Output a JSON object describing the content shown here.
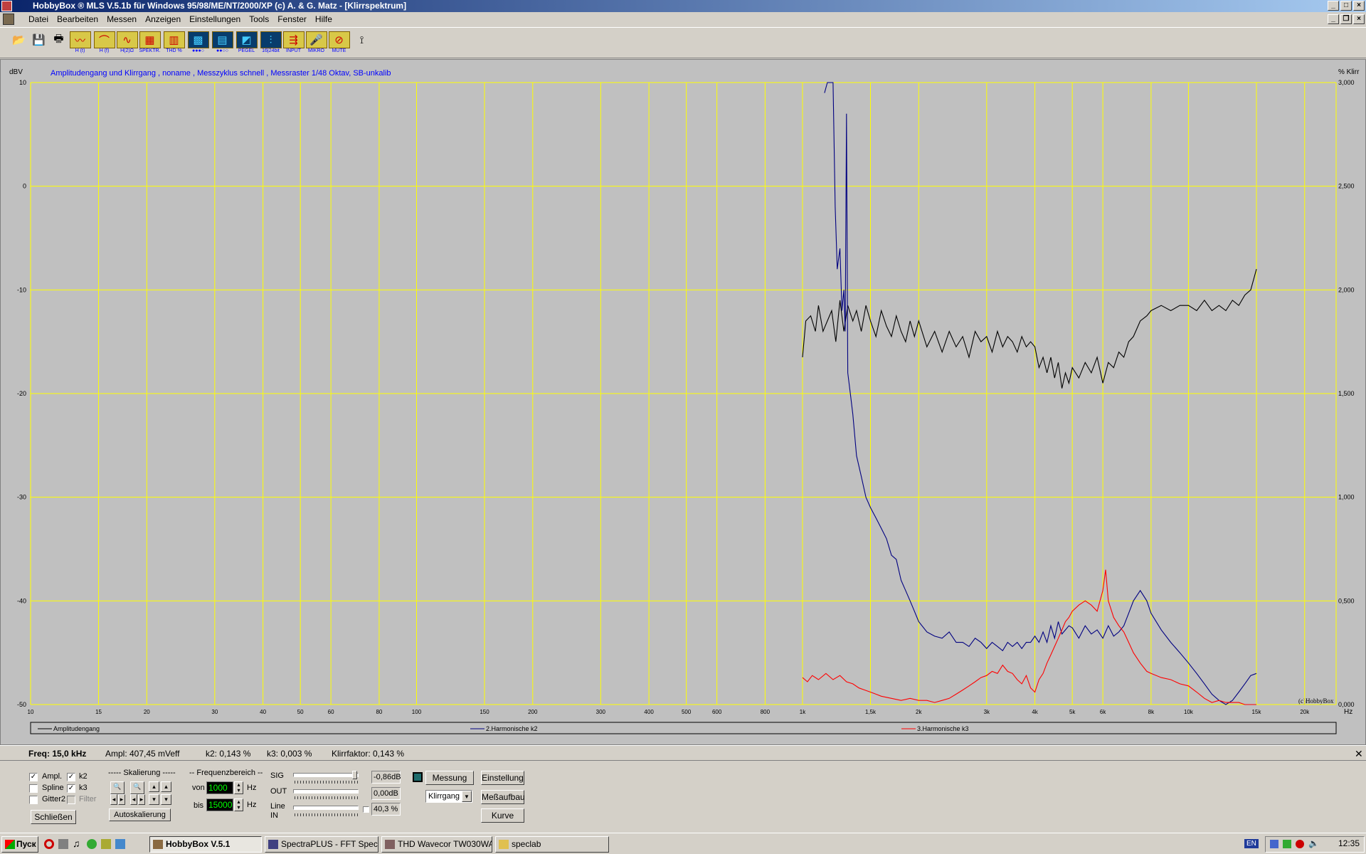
{
  "window": {
    "title": "HobbyBox ® MLS  V.5.1b   für Windows 95/98/ME/NT/2000/XP      (c)  A. & G. Matz - [Klirrspektrum]"
  },
  "menu": [
    "Datei",
    "Bearbeiten",
    "Messen",
    "Anzeigen",
    "Einstellungen",
    "Tools",
    "Fenster",
    "Hilfe"
  ],
  "toolbar": [
    {
      "icon": "open-folder-icon",
      "label": ""
    },
    {
      "icon": "save-icon",
      "label": ""
    },
    {
      "icon": "print-icon",
      "label": ""
    },
    {
      "icon": "impulse-response-icon",
      "label": "H (t)"
    },
    {
      "icon": "frequency-response-icon",
      "label": "H (f)"
    },
    {
      "icon": "impedance-icon",
      "label": "H(2)Ω"
    },
    {
      "icon": "spectrum-icon",
      "label": "SPEKTR."
    },
    {
      "icon": "thd-icon",
      "label": "THD %"
    },
    {
      "icon": "oscilloscope-icon",
      "label": "●●●○"
    },
    {
      "icon": "bar-spectrum-icon",
      "label": "●●○○"
    },
    {
      "icon": "level-icon",
      "label": "PEGEL"
    },
    {
      "icon": "bit-depth-icon",
      "label": "16|24bit"
    },
    {
      "icon": "input-icon",
      "label": "INPUT"
    },
    {
      "icon": "microphone-icon",
      "label": "MIKRO"
    },
    {
      "icon": "mute-icon",
      "label": "MUTE"
    },
    {
      "icon": "tool-icon",
      "label": ""
    }
  ],
  "chart_data": {
    "type": "line",
    "title": "Amplitudengang und Klirrgang , noname , Messzyklus schnell , Messraster 1/48 Oktav, SB-unkalib",
    "ylabel": "dBV",
    "ylabel_right": "% Klirr",
    "xunit": "Hz",
    "xscale": "log",
    "xlim": [
      10,
      30000
    ],
    "ylim": [
      -50,
      10
    ],
    "ylim_right": [
      0,
      3
    ],
    "yticks": [
      "10",
      "0",
      "-10",
      "-20",
      "-30",
      "-40",
      "-50"
    ],
    "yticks_right": [
      "3,000",
      "2,500",
      "2,000",
      "1,500",
      "1,000",
      "0,500",
      "0,000"
    ],
    "xticks": [
      {
        "v": 10,
        "l": "10"
      },
      {
        "v": 15,
        "l": "15"
      },
      {
        "v": 20,
        "l": "20"
      },
      {
        "v": 30,
        "l": "30"
      },
      {
        "v": 40,
        "l": "40"
      },
      {
        "v": 50,
        "l": "50"
      },
      {
        "v": 60,
        "l": "60"
      },
      {
        "v": 80,
        "l": "80"
      },
      {
        "v": 100,
        "l": "100"
      },
      {
        "v": 150,
        "l": "150"
      },
      {
        "v": 200,
        "l": "200"
      },
      {
        "v": 300,
        "l": "300"
      },
      {
        "v": 400,
        "l": "400"
      },
      {
        "v": 500,
        "l": "500"
      },
      {
        "v": 600,
        "l": "600"
      },
      {
        "v": 800,
        "l": "800"
      },
      {
        "v": 1000,
        "l": "1k"
      },
      {
        "v": 1500,
        "l": "1,5k"
      },
      {
        "v": 2000,
        "l": "2k"
      },
      {
        "v": 3000,
        "l": "3k"
      },
      {
        "v": 4000,
        "l": "4k"
      },
      {
        "v": 5000,
        "l": "5k"
      },
      {
        "v": 6000,
        "l": "6k"
      },
      {
        "v": 8000,
        "l": "8k"
      },
      {
        "v": 10000,
        "l": "10k"
      },
      {
        "v": 15000,
        "l": "15k"
      },
      {
        "v": 20000,
        "l": "20k"
      }
    ],
    "grid": true,
    "watermark": "(c)HobbyBox",
    "series": [
      {
        "name": "Amplitudengang",
        "color": "#000000",
        "axis": "left",
        "x": [
          1000,
          1020,
          1050,
          1080,
          1100,
          1130,
          1160,
          1190,
          1220,
          1250,
          1280,
          1310,
          1350,
          1380,
          1420,
          1460,
          1500,
          1550,
          1600,
          1650,
          1700,
          1750,
          1800,
          1850,
          1900,
          1950,
          2000,
          2100,
          2200,
          2300,
          2400,
          2500,
          2600,
          2700,
          2800,
          2900,
          3000,
          3100,
          3200,
          3300,
          3400,
          3500,
          3600,
          3700,
          3800,
          3900,
          4000,
          4100,
          4200,
          4300,
          4400,
          4500,
          4600,
          4700,
          4800,
          4900,
          5000,
          5200,
          5400,
          5600,
          5800,
          6000,
          6200,
          6400,
          6600,
          6800,
          7000,
          7200,
          7500,
          7800,
          8000,
          8500,
          9000,
          9500,
          10000,
          10500,
          11000,
          11500,
          12000,
          12500,
          13000,
          13500,
          14000,
          14500,
          15000
        ],
        "y": [
          -16.5,
          -13,
          -12.5,
          -14,
          -11.5,
          -14,
          -13,
          -12,
          -15,
          -11,
          -14,
          -11.5,
          -13,
          -12,
          -14,
          -11.5,
          -13,
          -14.5,
          -12,
          -13.5,
          -14.5,
          -12.5,
          -14,
          -15,
          -13,
          -14.5,
          -13,
          -15.5,
          -14,
          -16,
          -14,
          -15.5,
          -14.5,
          -16.5,
          -14,
          -15,
          -14.5,
          -16,
          -14,
          -15.5,
          -14.5,
          -15,
          -16,
          -14.5,
          -15.5,
          -15,
          -15.5,
          -17.5,
          -16.5,
          -18,
          -16.5,
          -18.5,
          -17,
          -19.5,
          -18,
          -19,
          -17.5,
          -18.5,
          -17,
          -18,
          -16.5,
          -19,
          -17,
          -17.5,
          -16,
          -16.5,
          -15,
          -14.5,
          -13,
          -12.5,
          -12,
          -11.5,
          -12,
          -11.5,
          -11.5,
          -12,
          -11,
          -12,
          -11.5,
          -12,
          -11,
          -11.5,
          -10.5,
          -10,
          -8
        ]
      },
      {
        "name": "2.Harmonische k2",
        "color": "#000080",
        "axis": "right",
        "x": [
          1140,
          1160,
          1180,
          1200,
          1215,
          1230,
          1250,
          1265,
          1280,
          1290,
          1300,
          1310,
          1330,
          1350,
          1380,
          1420,
          1460,
          1500,
          1550,
          1600,
          1650,
          1700,
          1750,
          1800,
          1850,
          1900,
          1950,
          2000,
          2100,
          2200,
          2300,
          2400,
          2500,
          2600,
          2700,
          2800,
          2900,
          3000,
          3100,
          3200,
          3300,
          3400,
          3500,
          3600,
          3700,
          3800,
          3900,
          4000,
          4100,
          4200,
          4300,
          4400,
          4500,
          4600,
          4700,
          4800,
          4900,
          5000,
          5200,
          5400,
          5600,
          5800,
          6000,
          6200,
          6400,
          6600,
          6800,
          7000,
          7200,
          7500,
          7800,
          8000,
          8500,
          9000,
          9500,
          10000,
          10500,
          11000,
          11500,
          12000,
          12500,
          13000,
          13500,
          14000,
          14500,
          15000
        ],
        "y": [
          2.95,
          3.0,
          3.0,
          3.0,
          2.4,
          2.1,
          2.2,
          1.9,
          2.0,
          1.8,
          2.85,
          1.6,
          1.5,
          1.4,
          1.2,
          1.1,
          1.0,
          0.95,
          0.9,
          0.85,
          0.8,
          0.72,
          0.7,
          0.6,
          0.55,
          0.5,
          0.45,
          0.4,
          0.35,
          0.33,
          0.32,
          0.35,
          0.3,
          0.3,
          0.28,
          0.32,
          0.3,
          0.27,
          0.3,
          0.28,
          0.26,
          0.3,
          0.28,
          0.3,
          0.27,
          0.3,
          0.3,
          0.33,
          0.3,
          0.35,
          0.3,
          0.38,
          0.32,
          0.4,
          0.34,
          0.36,
          0.38,
          0.37,
          0.32,
          0.38,
          0.34,
          0.36,
          0.32,
          0.38,
          0.33,
          0.35,
          0.38,
          0.44,
          0.5,
          0.55,
          0.5,
          0.44,
          0.36,
          0.3,
          0.25,
          0.2,
          0.15,
          0.1,
          0.05,
          0.02,
          0.0,
          0.02,
          0.06,
          0.1,
          0.14,
          0.15
        ]
      },
      {
        "name": "3.Harmonische k3",
        "color": "#ff0000",
        "axis": "right",
        "x": [
          1000,
          1030,
          1060,
          1100,
          1150,
          1200,
          1250,
          1300,
          1350,
          1400,
          1450,
          1500,
          1550,
          1600,
          1700,
          1800,
          1900,
          2000,
          2100,
          2200,
          2300,
          2400,
          2500,
          2600,
          2700,
          2800,
          2900,
          3000,
          3100,
          3200,
          3300,
          3400,
          3500,
          3600,
          3700,
          3800,
          3900,
          4000,
          4100,
          4200,
          4300,
          4400,
          4500,
          4600,
          4700,
          4800,
          4900,
          5000,
          5200,
          5400,
          5600,
          5800,
          6000,
          6100,
          6200,
          6400,
          6600,
          6800,
          7000,
          7200,
          7500,
          7800,
          8000,
          8500,
          9000,
          9500,
          10000,
          10500,
          11000,
          11500,
          12000,
          12500,
          13000,
          13500,
          14000,
          14500,
          15000
        ],
        "y": [
          0.13,
          0.11,
          0.14,
          0.12,
          0.15,
          0.12,
          0.14,
          0.11,
          0.1,
          0.08,
          0.07,
          0.06,
          0.05,
          0.04,
          0.03,
          0.02,
          0.03,
          0.02,
          0.02,
          0.01,
          0.02,
          0.03,
          0.05,
          0.07,
          0.09,
          0.11,
          0.13,
          0.14,
          0.16,
          0.15,
          0.19,
          0.16,
          0.15,
          0.12,
          0.1,
          0.14,
          0.08,
          0.06,
          0.12,
          0.15,
          0.2,
          0.24,
          0.28,
          0.32,
          0.36,
          0.4,
          0.42,
          0.45,
          0.48,
          0.5,
          0.48,
          0.45,
          0.55,
          0.65,
          0.5,
          0.42,
          0.38,
          0.35,
          0.3,
          0.25,
          0.2,
          0.16,
          0.15,
          0.13,
          0.12,
          0.1,
          0.09,
          0.06,
          0.03,
          0.01,
          0.02,
          0.01,
          0.01,
          0.01,
          0.0,
          0.0,
          0.0
        ]
      }
    ]
  },
  "legend": [
    "Amplitudengang",
    "2.Harmonische k2",
    "3.Harmonische k3"
  ],
  "status": {
    "freq": "Freq: 15,0 kHz",
    "ampl": "Ampl: 407,45 mVeff",
    "k2": "k2:  0,143 %",
    "k3": "k3:  0,003 %",
    "klirr": "Klirrfaktor:  0,143 %"
  },
  "panel": {
    "cb_ampl": "Ampl.",
    "cb_k2": "k2",
    "cb_spline": "Spline",
    "cb_k3": "k3",
    "cb_gitter": "Gitter2",
    "cb_filter": "Filter",
    "close_btn": "Schließen",
    "skalierung": "----- Skalierung -----",
    "autoskal": "Autoskalierung",
    "freqbereich": "-- Frequenzbereich --",
    "von_label": "von",
    "von_value": "1000",
    "hz1": "Hz",
    "bis_label": "bis",
    "bis_value": "15000",
    "hz2": "Hz",
    "sig": "SIG",
    "sig_val": "-0,86dB",
    "out": "OUT",
    "out_val": "0,00dB",
    "line": "Line",
    "in": "IN",
    "line_val": "40,3 %",
    "messung": "Messung",
    "einstellung": "Einstellung",
    "select": "Klirrgang",
    "messaufbau": "Meßaufbau",
    "kurve": "Kurve"
  },
  "taskbar": {
    "start": "Пуск",
    "tasks": [
      "HobbyBox V.5.1",
      "SpectraPLUS - FFT Spect...",
      "THD Wavecor TW030WA...",
      "speclab"
    ],
    "lang": "EN",
    "clock": "12:35"
  }
}
